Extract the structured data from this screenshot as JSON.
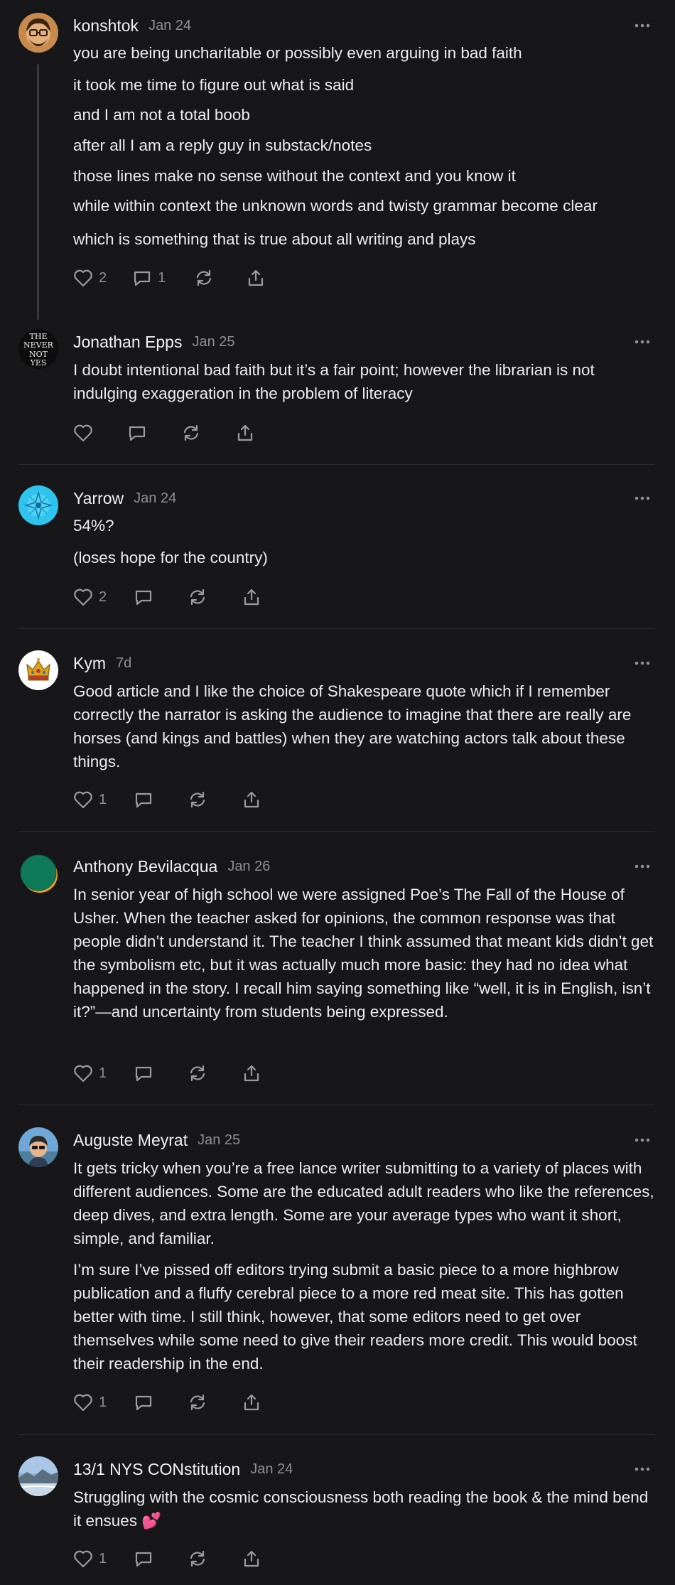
{
  "comments": [
    {
      "author": "konshtok",
      "date": "Jan 24",
      "paragraphs": [
        "you are being uncharitable or possibly even arguing in bad faith",
        "it took me time to figure out what is said",
        "and I am not a total boob",
        "after all I am a reply guy in substack/notes",
        "those lines make no sense without the context and you know it",
        "while within context the unknown words and twisty grammar become clear",
        "which is something that is true about all writing and plays"
      ],
      "likes": "2",
      "replies": "1"
    },
    {
      "author": "Jonathan Epps",
      "date": "Jan 25",
      "avatar_text": [
        "THE",
        "NEVER",
        "NOT",
        "YES"
      ],
      "paragraphs": [
        "I doubt intentional bad faith but it’s a fair point; however the librarian is not indulging exaggeration in the problem of literacy"
      ]
    },
    {
      "author": "Yarrow",
      "date": "Jan 24",
      "paragraphs": [
        "54%?",
        "(loses hope for the country)"
      ],
      "likes": "2"
    },
    {
      "author": "Kym",
      "date": "7d",
      "paragraphs": [
        "Good article and I like the choice of Shakespeare quote which if I remember correctly the narrator is asking the audience to imagine that there are really are horses (and kings and battles) when they are watching actors talk about these things."
      ],
      "likes": "1"
    },
    {
      "author": "Anthony Bevilacqua",
      "date": "Jan 26",
      "paragraphs": [
        "In senior year of high school we were assigned Poe’s The Fall of the House of Usher. When the teacher asked for opinions, the common response was that people didn’t understand it. The teacher I think assumed that meant kids didn’t get the symbolism etc, but it was actually much more basic: they had no idea what happened in the story. I recall him saying something like “well, it is in English, isn’t it?”—and uncertainty from students being expressed."
      ],
      "likes": "1"
    },
    {
      "author": "Auguste Meyrat",
      "date": "Jan 25",
      "paragraphs": [
        "It gets tricky when you’re a free lance writer submitting to a variety of places with different audiences. Some are the educated adult readers who like the references, deep dives, and extra length. Some are your average types who want it short, simple, and familiar.",
        "I’m sure I’ve pissed off editors trying submit a basic piece to a more highbrow publication and a fluffy cerebral piece to a more red meat site. This has gotten better with time. I still think, however, that some editors need to get over themselves while some need to give their readers more credit. This would boost their readership in the end."
      ],
      "likes": "1"
    },
    {
      "author": "13/1 NYS CONstitution",
      "date": "Jan 24",
      "paragraphs": [
        "Struggling with the cosmic consciousness both reading the book & the mind bend it ensues 💕"
      ],
      "likes": "1"
    }
  ]
}
